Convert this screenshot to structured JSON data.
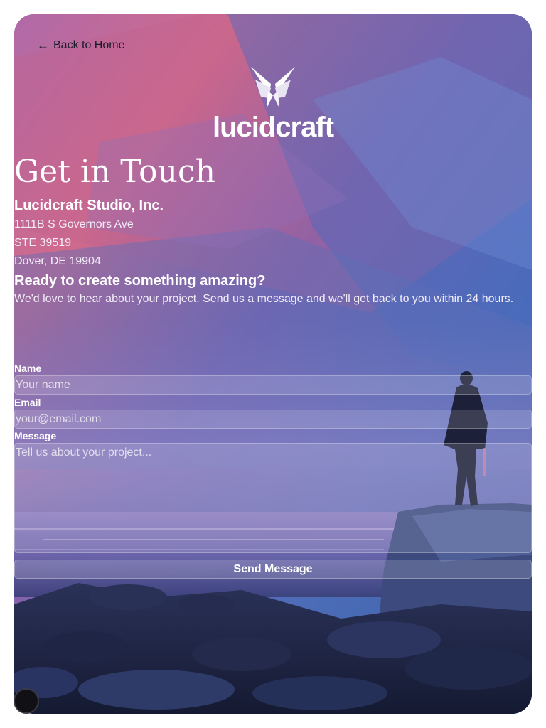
{
  "nav": {
    "back_label": "Back to Home",
    "back_icon": "arrow-left-icon"
  },
  "brand": {
    "logo_text": "lucidcraft",
    "logo_icon": "butterfly-logo-icon"
  },
  "page": {
    "title": "Get in Touch"
  },
  "company": {
    "name": "Lucidcraft Studio, Inc.",
    "address_line1": "1111B S Governors Ave",
    "address_line2": "STE 39519",
    "address_line3": "Dover, DE 19904"
  },
  "intro": {
    "heading": "Ready to create something amazing?",
    "body": "We'd love to hear about your project. Send us a message and we'll get back to you within 24 hours."
  },
  "form": {
    "name_label": "Name",
    "name_placeholder": "Your name",
    "email_label": "Email",
    "email_placeholder": "your@email.com",
    "message_label": "Message",
    "message_placeholder": "Tell us about your project...",
    "submit_label": "Send Message"
  },
  "colors": {
    "text": "#ffffff",
    "back_link": "#1a1a2a",
    "sky_pink": "#c86a9e",
    "sky_blue": "#5a78c2",
    "water": "#7a7ab8",
    "rocks": "#1c2440"
  }
}
